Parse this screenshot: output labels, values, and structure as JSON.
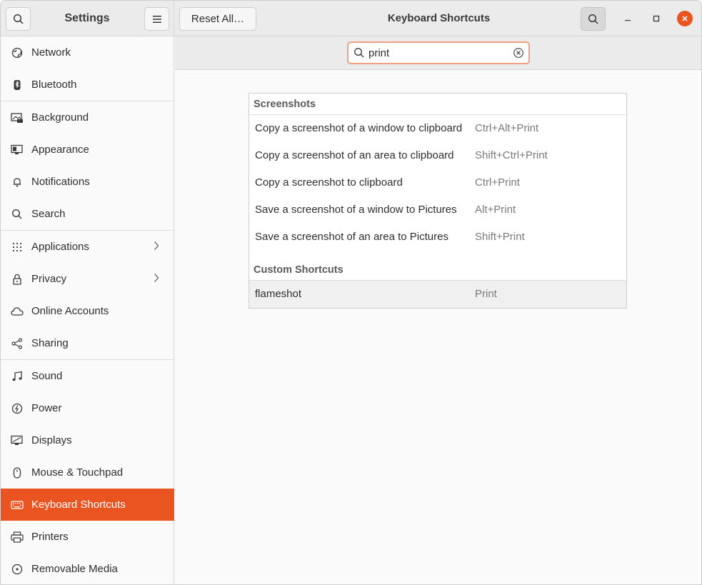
{
  "sidebar_header": {
    "title": "Settings"
  },
  "header": {
    "reset_label": "Reset All…",
    "title": "Keyboard Shortcuts"
  },
  "search": {
    "value": "print"
  },
  "sidebar": {
    "items": [
      {
        "label": "Network",
        "icon": "network-icon"
      },
      {
        "label": "Bluetooth",
        "icon": "bluetooth-icon"
      },
      {
        "label": "Background",
        "icon": "background-icon"
      },
      {
        "label": "Appearance",
        "icon": "appearance-icon"
      },
      {
        "label": "Notifications",
        "icon": "bell-icon"
      },
      {
        "label": "Search",
        "icon": "search-icon"
      },
      {
        "label": "Applications",
        "icon": "grid-icon"
      },
      {
        "label": "Privacy",
        "icon": "lock-icon"
      },
      {
        "label": "Online Accounts",
        "icon": "cloud-icon"
      },
      {
        "label": "Sharing",
        "icon": "share-icon"
      },
      {
        "label": "Sound",
        "icon": "music-note-icon"
      },
      {
        "label": "Power",
        "icon": "power-icon"
      },
      {
        "label": "Displays",
        "icon": "display-icon"
      },
      {
        "label": "Mouse & Touchpad",
        "icon": "mouse-icon"
      },
      {
        "label": "Keyboard Shortcuts",
        "icon": "keyboard-icon",
        "active": true
      },
      {
        "label": "Printers",
        "icon": "printer-icon"
      },
      {
        "label": "Removable Media",
        "icon": "media-icon"
      }
    ]
  },
  "sections": [
    {
      "title": "Screenshots",
      "rows": [
        {
          "name": "Copy a screenshot of a window to clipboard",
          "accel": "Ctrl+Alt+Print"
        },
        {
          "name": "Copy a screenshot of an area to clipboard",
          "accel": "Shift+Ctrl+Print"
        },
        {
          "name": "Copy a screenshot to clipboard",
          "accel": "Ctrl+Print"
        },
        {
          "name": "Save a screenshot of a window to Pictures",
          "accel": "Alt+Print"
        },
        {
          "name": "Save a screenshot of an area to Pictures",
          "accel": "Shift+Print"
        }
      ]
    },
    {
      "title": "Custom Shortcuts",
      "rows": [
        {
          "name": "flameshot",
          "accel": "Print"
        }
      ]
    }
  ],
  "colors": {
    "accent": "#e95420",
    "search_border": "#f0a07f"
  }
}
